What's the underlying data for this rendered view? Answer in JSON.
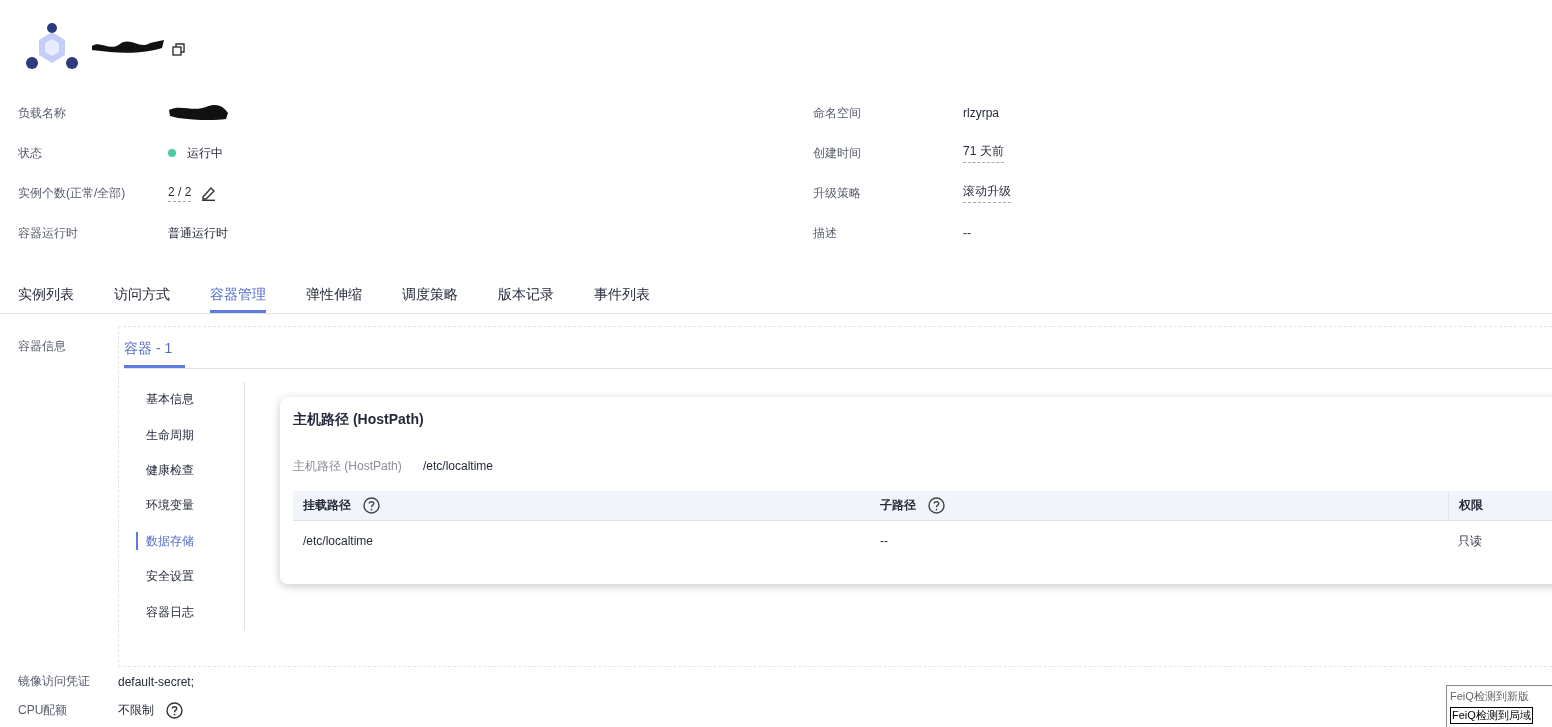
{
  "details_left": [
    {
      "label": "负载名称",
      "kind": "redacted"
    },
    {
      "label": "状态",
      "value": "运行中",
      "kind": "status"
    },
    {
      "label": "实例个数(正常/全部)",
      "value": "2 / 2",
      "kind": "editable"
    },
    {
      "label": "容器运行时",
      "value": "普通运行时",
      "kind": "plain"
    }
  ],
  "details_right": [
    {
      "label": "命名空间",
      "value": "rlzyrpa",
      "kind": "plain"
    },
    {
      "label": "创建时间",
      "value": "71 天前",
      "kind": "dotted"
    },
    {
      "label": "升级策略",
      "value": "滚动升级",
      "kind": "dotted"
    },
    {
      "label": "描述",
      "value": "--",
      "kind": "plain"
    }
  ],
  "tabs": [
    {
      "label": "实例列表",
      "selected": false
    },
    {
      "label": "访问方式",
      "selected": false
    },
    {
      "label": "容器管理",
      "selected": true
    },
    {
      "label": "弹性伸缩",
      "selected": false
    },
    {
      "label": "调度策略",
      "selected": false
    },
    {
      "label": "版本记录",
      "selected": false
    },
    {
      "label": "事件列表",
      "selected": false
    }
  ],
  "container_info": {
    "label": "容器信息",
    "container_tabs": [
      {
        "label": "容器 - 1",
        "selected": true
      }
    ],
    "side_menu": [
      {
        "label": "基本信息",
        "selected": false
      },
      {
        "label": "生命周期",
        "selected": false
      },
      {
        "label": "健康检查",
        "selected": false
      },
      {
        "label": "环境变量",
        "selected": false
      },
      {
        "label": "数据存储",
        "selected": true
      },
      {
        "label": "安全设置",
        "selected": false
      },
      {
        "label": "容器日志",
        "selected": false
      }
    ]
  },
  "hostpath_card": {
    "title": "主机路径 (HostPath)",
    "field_label": "主机路径 (HostPath)",
    "field_value": "/etc/localtime",
    "columns": [
      {
        "label": "挂载路径",
        "help": true
      },
      {
        "label": "子路径",
        "help": true
      },
      {
        "label": "权限",
        "help": false
      }
    ],
    "rows": [
      [
        "/etc/localtime",
        "--",
        "只读"
      ]
    ]
  },
  "bottom_fields": [
    {
      "label": "镜像访问凭证",
      "value": "default-secret;",
      "help": false
    },
    {
      "label": "CPU配额",
      "value": "不限制",
      "help": true
    }
  ],
  "notification": {
    "lines": [
      "FeiQ检测到新版",
      "FeiQ检测到局域"
    ]
  }
}
